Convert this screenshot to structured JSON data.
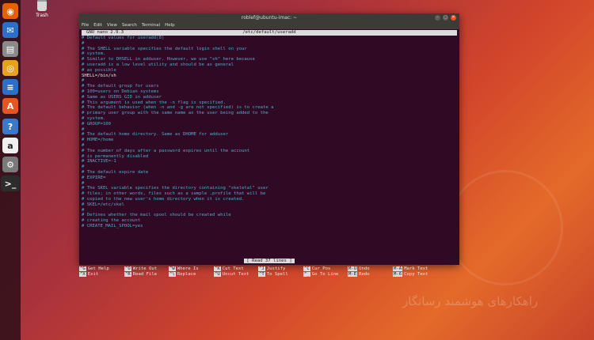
{
  "desktop": {
    "trash_label": "Trash",
    "watermark": "راهکارهای هوشمند رسانگار"
  },
  "launcher": [
    {
      "icon": "firefox-icon",
      "glyph": "◉",
      "color": "#e66000"
    },
    {
      "icon": "thunderbird-icon",
      "glyph": "✉",
      "color": "#2a6fc9"
    },
    {
      "icon": "files-icon",
      "glyph": "▤",
      "color": "#8a8a8a"
    },
    {
      "icon": "rhythmbox-icon",
      "glyph": "◎",
      "color": "#e6a21c"
    },
    {
      "icon": "writer-icon",
      "glyph": "≡",
      "color": "#2a6fc9"
    },
    {
      "icon": "software-center-icon",
      "glyph": "A",
      "color": "#e95420"
    },
    {
      "icon": "help-icon",
      "glyph": "?",
      "color": "#3a78c9"
    },
    {
      "icon": "amazon-icon",
      "glyph": "a",
      "color": "#f0f0f0"
    },
    {
      "icon": "settings-icon",
      "glyph": "⚙",
      "color": "#7a7a7a"
    },
    {
      "icon": "terminal-icon",
      "glyph": ">_",
      "color": "#3c3b37"
    }
  ],
  "window": {
    "title": "roblef@ubuntu-imac: ~",
    "menu": [
      "File",
      "Edit",
      "View",
      "Search",
      "Terminal",
      "Help"
    ]
  },
  "nano": {
    "version": "GNU nano 2.9.3",
    "filename": "/etc/default/useradd",
    "lines": [
      {
        "text": "# Default values for useradd(8)",
        "plain": false
      },
      {
        "text": "#",
        "plain": false
      },
      {
        "text": "# The SHELL variable specifies the default login shell on your",
        "plain": false
      },
      {
        "text": "# system.",
        "plain": false
      },
      {
        "text": "# Similar to DHSELL in adduser. However, we use \"sh\" here because",
        "plain": false
      },
      {
        "text": "# useradd is a low level utility and should be as general",
        "plain": false
      },
      {
        "text": "# as possible",
        "plain": false
      },
      {
        "text": "SHELL=/bin/sh",
        "plain": true
      },
      {
        "text": "#",
        "plain": false
      },
      {
        "text": "# The default group for users",
        "plain": false
      },
      {
        "text": "# 100=users on Debian systems",
        "plain": false
      },
      {
        "text": "# Same as USERS_GID in adduser",
        "plain": false
      },
      {
        "text": "# This argument is used when the -n flag is specified.",
        "plain": false
      },
      {
        "text": "# The default behavior (when -n and -g are not specified) is to create a",
        "plain": false
      },
      {
        "text": "# primary user group with the same name as the user being added to the",
        "plain": false
      },
      {
        "text": "# system.",
        "plain": false
      },
      {
        "text": "# GROUP=100",
        "plain": false
      },
      {
        "text": "#",
        "plain": false
      },
      {
        "text": "# The default home directory. Same as DHOME for adduser",
        "plain": false
      },
      {
        "text": "# HOME=/home",
        "plain": false
      },
      {
        "text": "#",
        "plain": false
      },
      {
        "text": "# The number of days after a password expires until the account",
        "plain": false
      },
      {
        "text": "# is permanently disabled",
        "plain": false
      },
      {
        "text": "# INACTIVE=-1",
        "plain": false
      },
      {
        "text": "#",
        "plain": false
      },
      {
        "text": "# The default expire date",
        "plain": false
      },
      {
        "text": "# EXPIRE=",
        "plain": false
      },
      {
        "text": "#",
        "plain": false
      },
      {
        "text": "# The SKEL variable specifies the directory containing \"skeletal\" user",
        "plain": false
      },
      {
        "text": "# files; in other words, files such as a sample .profile that will be",
        "plain": false
      },
      {
        "text": "# copied to the new user's home directory when it is created.",
        "plain": false
      },
      {
        "text": "# SKEL=/etc/skel",
        "plain": false
      },
      {
        "text": "#",
        "plain": false
      },
      {
        "text": "# Defines whether the mail spool should be created while",
        "plain": false
      },
      {
        "text": "# creating the account",
        "plain": false
      },
      {
        "text": "# CREATE_MAIL_SPOOL=yes",
        "plain": false
      }
    ],
    "status": "[ Read 37 lines ]",
    "shortcuts": [
      [
        {
          "key": "^G",
          "label": "Get Help"
        },
        {
          "key": "^O",
          "label": "Write Out"
        },
        {
          "key": "^W",
          "label": "Where Is"
        },
        {
          "key": "^K",
          "label": "Cut Text"
        },
        {
          "key": "^J",
          "label": "Justify"
        },
        {
          "key": "^C",
          "label": "Cur Pos"
        },
        {
          "key": "M-U",
          "label": "Undo"
        },
        {
          "key": "M-A",
          "label": "Mark Text"
        }
      ],
      [
        {
          "key": "^X",
          "label": "Exit"
        },
        {
          "key": "^R",
          "label": "Read File"
        },
        {
          "key": "^\\",
          "label": "Replace"
        },
        {
          "key": "^U",
          "label": "Uncut Text"
        },
        {
          "key": "^T",
          "label": "To Spell"
        },
        {
          "key": "^_",
          "label": "Go To Line"
        },
        {
          "key": "M-E",
          "label": "Redo"
        },
        {
          "key": "M-6",
          "label": "Copy Text"
        }
      ]
    ]
  }
}
